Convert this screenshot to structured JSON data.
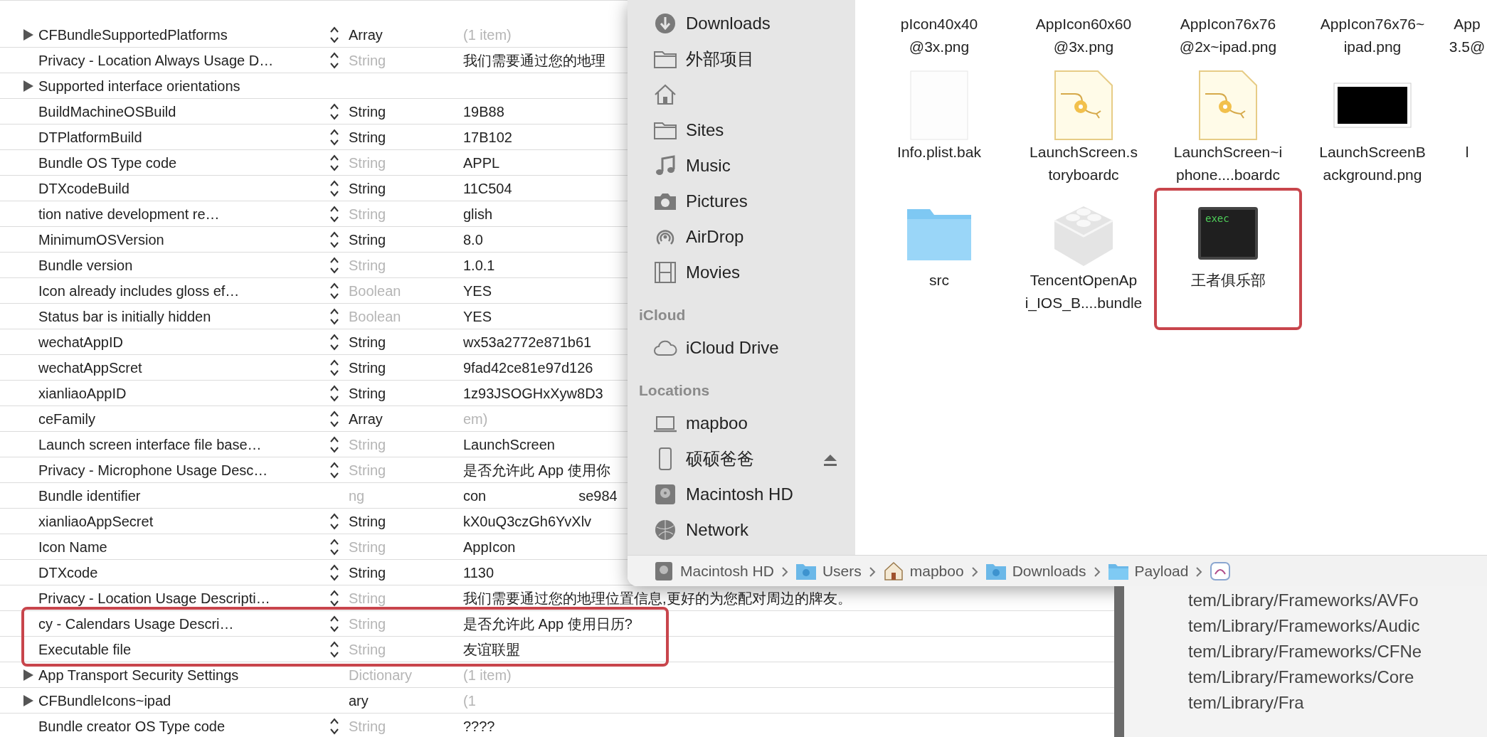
{
  "plist": {
    "rows": [
      {
        "key": "CFBundleSupportedPlatforms",
        "type": "Array",
        "value": "(1 item)",
        "disclosure": true,
        "stepper": true,
        "type_dimmed": false,
        "value_dimmed": true,
        "circled": false
      },
      {
        "key": "Privacy - Location Always Usage D…",
        "type": "String",
        "value": "我们需要通过您的地理",
        "disclosure": false,
        "stepper": true,
        "type_dimmed": true,
        "value_dimmed": false,
        "circled": false
      },
      {
        "key": "Supported interface orientations",
        "disclosure": true,
        "stepper": false,
        "circled": false
      },
      {
        "key": "BuildMachineOSBuild",
        "type": "String",
        "value": "19B88",
        "disclosure": false,
        "stepper": true,
        "type_dimmed": false,
        "value_dimmed": false,
        "circled": false
      },
      {
        "key": "DTPlatformBuild",
        "type": "String",
        "value": "17B102",
        "disclosure": false,
        "stepper": true,
        "type_dimmed": false,
        "value_dimmed": false,
        "circled": false
      },
      {
        "key": "Bundle OS Type code",
        "type": "String",
        "value": "APPL",
        "disclosure": false,
        "stepper": true,
        "type_dimmed": true,
        "value_dimmed": false,
        "circled": false
      },
      {
        "key": "DTXcodeBuild",
        "type": "String",
        "value": "11C504",
        "disclosure": false,
        "stepper": true,
        "type_dimmed": false,
        "value_dimmed": false,
        "circled": false
      },
      {
        "key": "tion native development re…",
        "type": "String",
        "value": "glish",
        "disclosure": false,
        "stepper": true,
        "type_dimmed": true,
        "value_dimmed": false,
        "circled": false
      },
      {
        "key": "MinimumOSVersion",
        "type": "String",
        "value": "8.0",
        "disclosure": false,
        "stepper": true,
        "type_dimmed": false,
        "value_dimmed": false,
        "circled": false
      },
      {
        "key": "Bundle version",
        "type": "String",
        "value": "1.0.1",
        "disclosure": false,
        "stepper": true,
        "type_dimmed": true,
        "value_dimmed": false,
        "circled": false
      },
      {
        "key": "Icon already includes gloss ef…",
        "type": "Boolean",
        "value": "YES",
        "disclosure": false,
        "stepper": true,
        "type_dimmed": true,
        "value_dimmed": false,
        "circled": false
      },
      {
        "key": "Status bar is initially hidden",
        "type": "Boolean",
        "value": "YES",
        "disclosure": false,
        "stepper": true,
        "type_dimmed": true,
        "value_dimmed": false,
        "circled": false
      },
      {
        "key": "wechatAppID",
        "type": "String",
        "value": "wx53a2772e871b61",
        "disclosure": false,
        "stepper": true,
        "type_dimmed": false,
        "value_dimmed": false,
        "circled": false
      },
      {
        "key": "wechatAppScret",
        "type": "String",
        "value": "9fad42ce81e97d126",
        "disclosure": false,
        "stepper": true,
        "type_dimmed": false,
        "value_dimmed": false,
        "circled": false
      },
      {
        "key": "xianliaoAppID",
        "type": "String",
        "value": "1z93JSOGHxXyw8D3",
        "disclosure": false,
        "stepper": true,
        "type_dimmed": false,
        "value_dimmed": false,
        "circled": false
      },
      {
        "key": "ceFamily",
        "type": "Array",
        "value": "em)",
        "disclosure": false,
        "stepper": true,
        "type_dimmed": false,
        "value_dimmed": true,
        "circled": false
      },
      {
        "key": "Launch screen interface file base…",
        "type": "String",
        "value": "LaunchScreen",
        "disclosure": false,
        "stepper": true,
        "type_dimmed": true,
        "value_dimmed": false,
        "circled": false
      },
      {
        "key": "Privacy - Microphone Usage Desc…",
        "type": "String",
        "value": "是否允许此 App 使用你",
        "disclosure": false,
        "stepper": true,
        "type_dimmed": true,
        "value_dimmed": false,
        "circled": false
      },
      {
        "key": "Bundle identifier",
        "type": "ng",
        "value": "con",
        "value_tail": "se984",
        "disclosure": false,
        "stepper": false,
        "type_dimmed": true,
        "value_dimmed": false,
        "circled": false
      },
      {
        "key": "xianliaoAppSecret",
        "type": "String",
        "value": "kX0uQ3czGh6YvXlv",
        "disclosure": false,
        "stepper": true,
        "type_dimmed": false,
        "value_dimmed": false,
        "circled": false
      },
      {
        "key": "Icon Name",
        "type": "String",
        "value": "AppIcon",
        "disclosure": false,
        "stepper": true,
        "type_dimmed": true,
        "value_dimmed": false,
        "circled": false
      },
      {
        "key": "DTXcode",
        "type": "String",
        "value": "1130",
        "disclosure": false,
        "stepper": true,
        "type_dimmed": false,
        "value_dimmed": false,
        "circled": false
      },
      {
        "key": "Privacy - Location Usage Descripti…",
        "type": "String",
        "value": "我们需要通过您的地理位置信息,更好的为您配对周边的牌友。",
        "disclosure": false,
        "stepper": true,
        "type_dimmed": true,
        "value_dimmed": false,
        "circled": false
      },
      {
        "key": "cy - Calendars Usage Descri…",
        "type": "String",
        "value": "是否允许此 App 使用日历?",
        "disclosure": false,
        "stepper": true,
        "type_dimmed": true,
        "value_dimmed": false,
        "circled": true
      },
      {
        "key": "Executable file",
        "type": "String",
        "value": "友谊联盟",
        "disclosure": false,
        "stepper": true,
        "type_dimmed": true,
        "value_dimmed": false,
        "circled": true
      },
      {
        "key": "App Transport Security Settings",
        "type": "Dictionary",
        "value": "(1 item)",
        "disclosure": true,
        "stepper": false,
        "type_dimmed": true,
        "value_dimmed": true,
        "circled": false
      },
      {
        "key": "CFBundleIcons~ipad",
        "type": "ary",
        "value": "(1",
        "disclosure": true,
        "stepper": false,
        "type_dimmed": false,
        "value_dimmed": true,
        "circled": false
      },
      {
        "key": "Bundle creator OS Type code",
        "type": "String",
        "value": "????",
        "disclosure": false,
        "stepper": true,
        "type_dimmed": true,
        "value_dimmed": false,
        "circled": false
      }
    ]
  },
  "finder": {
    "sidebar": [
      {
        "kind": "download",
        "label": "Downloads"
      },
      {
        "kind": "folder",
        "label": "外部项目"
      },
      {
        "kind": "home"
      },
      {
        "kind": "folder",
        "label": "Sites"
      },
      {
        "kind": "music",
        "label": "Music"
      },
      {
        "kind": "camera",
        "label": "Pictures"
      },
      {
        "kind": "airdrop",
        "label": "AirDrop"
      },
      {
        "kind": "film",
        "label": "Movies"
      },
      {
        "kind": "header",
        "label": "iCloud"
      },
      {
        "kind": "cloud",
        "label": "iCloud Drive"
      },
      {
        "kind": "header",
        "label": "Locations"
      },
      {
        "kind": "laptop",
        "label": "mapboo"
      },
      {
        "kind": "phone",
        "label": "硕硕爸爸",
        "ejectable": true
      },
      {
        "kind": "disk",
        "label": "Macintosh HD"
      },
      {
        "kind": "network",
        "label": "Network"
      }
    ],
    "files": [
      {
        "kind": "clipped",
        "label": "pIcon40x40\n@3x.png",
        "circled": false
      },
      {
        "kind": "clipped",
        "label": "AppIcon60x60\n@3x.png",
        "circled": false
      },
      {
        "kind": "clipped",
        "label": "AppIcon76x76\n@2x~ipad.png",
        "circled": false
      },
      {
        "kind": "clipped",
        "label": "AppIcon76x76~\nipad.png",
        "circled": false
      },
      {
        "kind": "clipped",
        "label": "App\n3.5@",
        "circled": false
      },
      {
        "kind": "document",
        "label": "Info.plist.bak",
        "circled": false
      },
      {
        "kind": "storyboard",
        "label": "LaunchScreen.s\ntoryboardc",
        "circled": false
      },
      {
        "kind": "storyboard",
        "label": "LaunchScreen~i\nphone....boardc",
        "circled": false
      },
      {
        "kind": "image",
        "label": "LaunchScreenB\nackground.png",
        "circled": false
      },
      {
        "kind": "clipped",
        "label": "l",
        "circled": false
      },
      {
        "kind": "folder",
        "label": "src",
        "circled": false
      },
      {
        "kind": "bundle",
        "label": "TencentOpenAp\ni_IOS_B....bundle",
        "circled": false
      },
      {
        "kind": "exec",
        "label": "王者俱乐部",
        "icon_text": "exec",
        "circled": true
      }
    ],
    "path": [
      {
        "kind": "disk",
        "label": "Macintosh HD"
      },
      {
        "kind": "users",
        "label": "Users"
      },
      {
        "kind": "home",
        "label": "mapboo"
      },
      {
        "kind": "downloads",
        "label": "Downloads"
      },
      {
        "kind": "folder",
        "label": "Payload"
      },
      {
        "kind": "app"
      }
    ]
  },
  "terminal": {
    "lines": [
      "tem/Library/Frameworks/AVFo",
      "tem/Library/Frameworks/Audic",
      "tem/Library/Frameworks/CFNe",
      "tem/Library/Frameworks/Core",
      "tem/Library/Fra"
    ]
  }
}
